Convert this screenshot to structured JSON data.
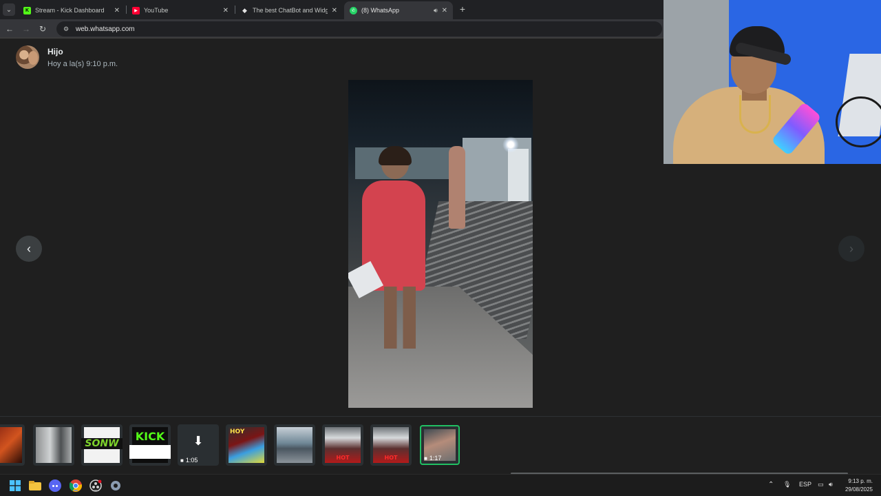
{
  "browser": {
    "tabs": [
      {
        "title": "Stream - Kick Dashboard",
        "favicon": "kick-icon",
        "active": false
      },
      {
        "title": "YouTube",
        "favicon": "youtube-icon",
        "active": false
      },
      {
        "title": "The best ChatBot and Widgets",
        "favicon": "botrix-icon",
        "active": false
      },
      {
        "title": "(8) WhatsApp",
        "favicon": "whatsapp-icon",
        "active": true
      }
    ],
    "url": "web.whatsapp.com"
  },
  "viewer": {
    "contact_name": "Hijo",
    "timestamp": "Hoy a la(s) 9:10 p.m."
  },
  "thumbnails": [
    {
      "kind": "image",
      "label": ""
    },
    {
      "kind": "image",
      "label": ""
    },
    {
      "kind": "image",
      "label": "SONW"
    },
    {
      "kind": "image",
      "label": "KICK"
    },
    {
      "kind": "video-download",
      "duration": "1:05"
    },
    {
      "kind": "image",
      "label": "HOY"
    },
    {
      "kind": "image",
      "label": ""
    },
    {
      "kind": "image",
      "label": "HOT"
    },
    {
      "kind": "image",
      "label": "HOT"
    },
    {
      "kind": "video",
      "duration": "1:17",
      "selected": true
    }
  ],
  "taskbar": {
    "language": "ESP",
    "time": "9:13 p. m.",
    "date": "29/08/2025"
  },
  "colors": {
    "whatsapp_green": "#21c063",
    "viewer_bg": "#1f1f1f",
    "kick_green": "#53fc18"
  }
}
